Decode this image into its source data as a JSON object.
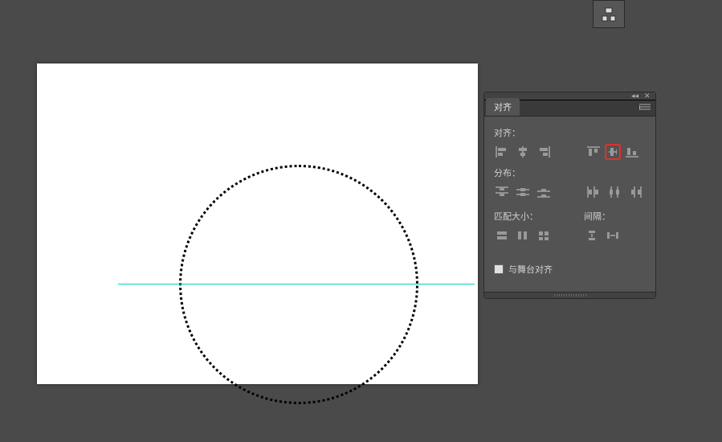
{
  "panel": {
    "tab": "对齐",
    "sections": {
      "align": "对齐：",
      "distribute": "分布：",
      "match_size": "匹配大小：",
      "spacing": "间隔："
    },
    "stage_align": "与舞台对齐"
  },
  "colors": {
    "highlight": "#e03030",
    "guide": "#00d4b4"
  }
}
